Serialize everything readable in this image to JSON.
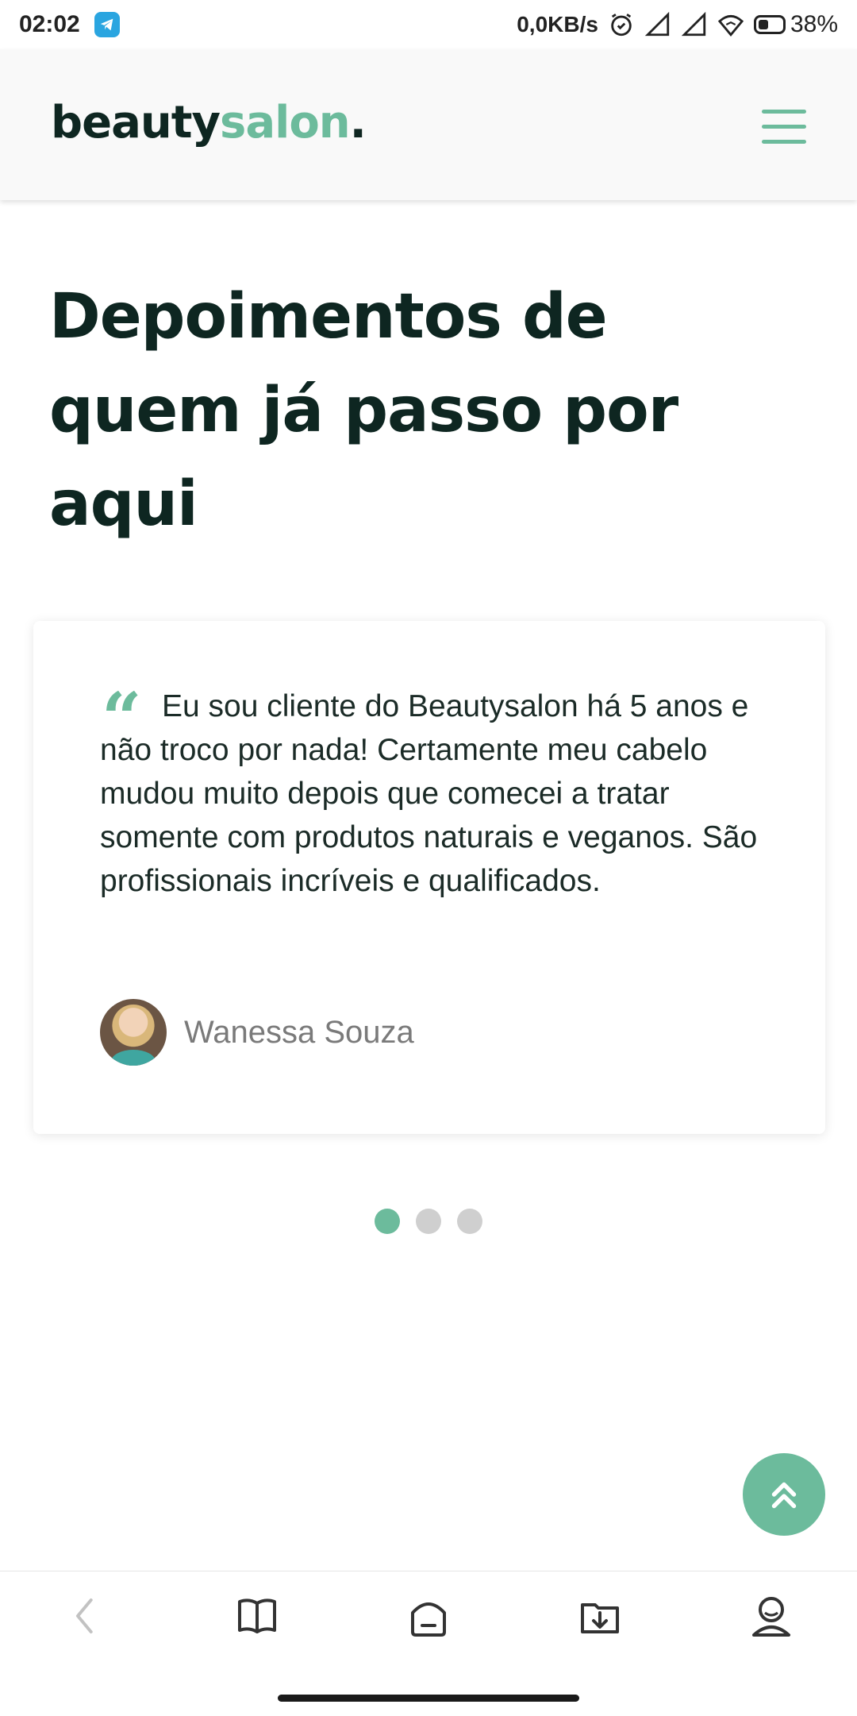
{
  "status": {
    "time": "02:02",
    "net_speed": "0,0KB/s",
    "battery": "38%"
  },
  "header": {
    "logo_part1": "beauty",
    "logo_part2": "salon",
    "logo_dot": "."
  },
  "section": {
    "title": "Depoimentos de quem já passo por aqui"
  },
  "testimonial": {
    "quote": "Eu sou cliente do Beautysalon há 5 anos e não troco por nada! Certamente meu cabelo mudou muito depois que comecei a tratar somente com produtos naturais e veganos. São profissionais incríveis e qualificados.",
    "author": "Wanessa Souza"
  },
  "carousel": {
    "slide_count": 3,
    "active_index": 0
  },
  "colors": {
    "accent": "#6cbb9c",
    "dark": "#0e2621"
  },
  "icons": {
    "menu": "hamburger-icon",
    "quote": "quote-icon",
    "to_top": "double-chevron-up-icon",
    "nav": [
      "back-icon",
      "book-icon",
      "home-icon",
      "download-icon",
      "profile-icon"
    ]
  }
}
